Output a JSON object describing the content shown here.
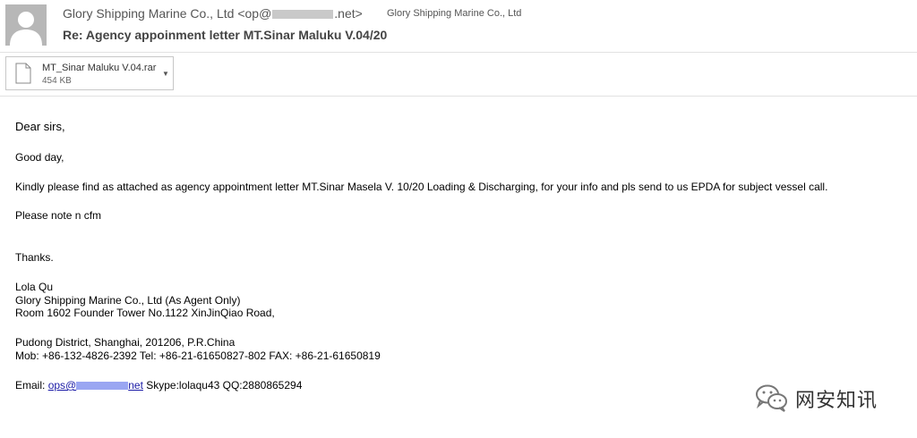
{
  "header": {
    "from_name": "Glory Shipping Marine Co., Ltd <op@",
    "from_domain": ".net>",
    "to": "Glory Shipping Marine Co., Ltd",
    "subject": "Re: Agency appoinment letter MT.Sinar Maluku V.04/20"
  },
  "attachment": {
    "name": "MT_Sinar Maluku V.04.rar",
    "size": "454 KB",
    "icon": "file-icon",
    "dropdown_icon": "chevron-down-icon"
  },
  "body": {
    "greeting": "Dear sirs,",
    "good_day": "Good day,",
    "paragraph": "Kindly please find as attached as agency appointment letter MT.Sinar Masela V. 10/20 Loading & Discharging,  for your info and pls send to us EPDA for subject vessel call.",
    "note": "Please note n cfm",
    "thanks": "Thanks."
  },
  "signature": {
    "name": "Lola Qu",
    "company": "Glory Shipping Marine Co., Ltd (As Agent Only)",
    "address1": "Room 1602 Founder Tower No.1122 XinJinQiao Road,",
    "address2": "Pudong District, Shanghai, 201206, P.R.China",
    "phones": "Mob: +86-132-4826-2392  Tel: +86-21-61650827-802  FAX: +86-21-61650819",
    "email_label": "Email: ",
    "email_prefix": "ops@",
    "email_suffix": "net",
    "skype_qq": " Skype:lolaqu43 QQ:2880865294"
  },
  "watermark": {
    "icon": "wechat-icon",
    "text": "网安知讯"
  }
}
